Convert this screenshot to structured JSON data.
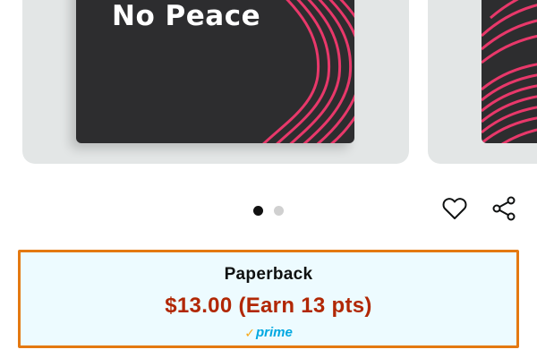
{
  "product": {
    "cover_title": "No Peace"
  },
  "carousel": {
    "active_index": 0,
    "total": 2
  },
  "actions": {
    "wishlist_icon": "heart-icon",
    "share_icon": "share-icon"
  },
  "format": {
    "label": "Paperback",
    "price": "$13.00 (Earn 13 pts)",
    "prime_check": "✓",
    "prime_label": "prime"
  },
  "colors": {
    "selected_border": "#e47911",
    "selected_bg": "#edfbff",
    "price": "#b12704",
    "prime_blue": "#00a8e1",
    "prime_check": "#f7a81b",
    "cover_bg": "#2d2d2f",
    "cover_stripes": "#e8386a"
  }
}
